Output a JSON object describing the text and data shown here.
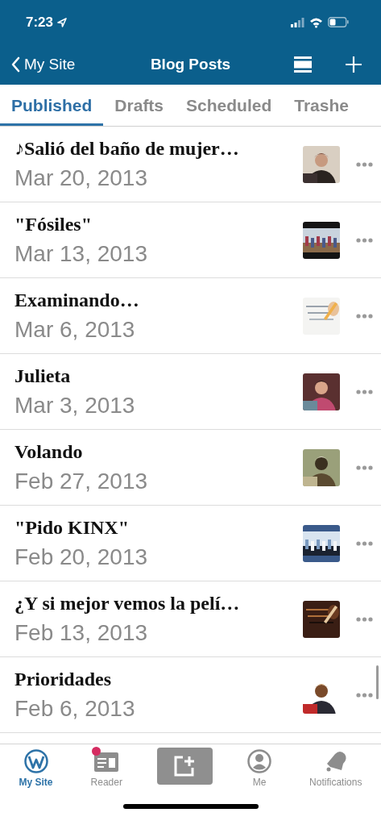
{
  "status_bar": {
    "time": "7:23"
  },
  "nav": {
    "back": "My Site",
    "title": "Blog Posts"
  },
  "tabs": [
    {
      "label": "Published",
      "selected": true
    },
    {
      "label": "Drafts",
      "selected": false
    },
    {
      "label": "Scheduled",
      "selected": false
    },
    {
      "label": "Trashe",
      "selected": false
    }
  ],
  "posts": [
    {
      "title": "♪Salió del baño de mujer…",
      "date": "Mar 20, 2013"
    },
    {
      "title": "\"Fósiles\"",
      "date": "Mar 13, 2013"
    },
    {
      "title": "Examinando…",
      "date": "Mar 6, 2013"
    },
    {
      "title": "Julieta",
      "date": "Mar 3, 2013"
    },
    {
      "title": "Volando",
      "date": "Feb 27, 2013"
    },
    {
      "title": "\"Pido KINX\"",
      "date": "Feb 20, 2013"
    },
    {
      "title": "¿Y si mejor vemos la pelí…",
      "date": "Feb 13, 2013"
    },
    {
      "title": "Prioridades",
      "date": "Feb 6, 2013"
    }
  ],
  "tab_bar": [
    {
      "kind": "my_site",
      "label": "My Site",
      "selected": true
    },
    {
      "kind": "reader",
      "label": "Reader",
      "selected": false,
      "badge": true
    },
    {
      "kind": "write",
      "selected": false
    },
    {
      "kind": "me",
      "label": "Me",
      "selected": false
    },
    {
      "kind": "notifications",
      "label": "Notifications",
      "selected": false
    }
  ]
}
